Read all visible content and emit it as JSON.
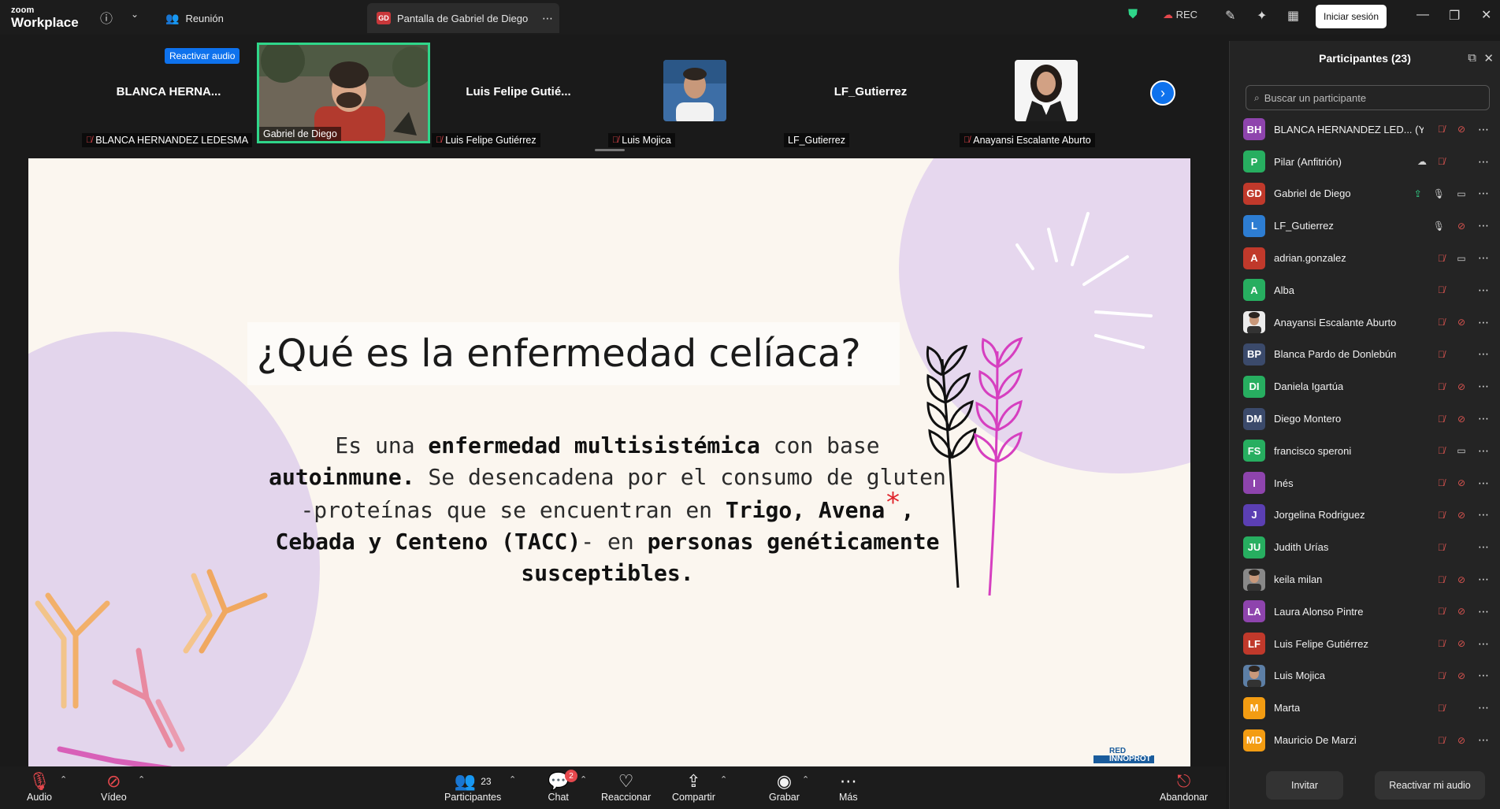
{
  "titlebar": {
    "brand_small": "zoom",
    "brand_large": "Workplace",
    "meeting_tab": "Reunión",
    "share_tab": "Pantalla de Gabriel de Diego",
    "share_badge": "GD",
    "rec_label": "REC",
    "login_button": "Iniciar sesión"
  },
  "gallery": {
    "reactivate_audio": "Reactivar audio",
    "tiles": [
      {
        "big_name": "BLANCA  HERNA...",
        "label": "BLANCA HERNANDEZ LEDESMA"
      },
      {
        "big_name": "",
        "label": "Gabriel de Diego"
      },
      {
        "big_name": "Luis  Felipe  Gutié...",
        "label": "Luis Felipe Gutiérrez"
      },
      {
        "big_name": "",
        "label": "Luis Mojica"
      },
      {
        "big_name": "LF_Gutierrez",
        "label": "LF_Gutierrez"
      },
      {
        "big_name": "",
        "label": "Anayansi Escalante Aburto"
      }
    ]
  },
  "slide": {
    "title": "¿Qué es la enfermedad celíaca?",
    "body": {
      "t1": "Es una ",
      "b1": "enfermedad multisistémica",
      "t2": " con base ",
      "b2": "autoinmune.",
      "t3": " Se desencadena por el consumo de gluten -proteínas que se encuentran en ",
      "b3": "Trigo, Avena",
      "asterisk": "*",
      "b4": ", Cebada y Centeno (TACC)",
      "t4": "- en ",
      "b5": "personas genéticamente susceptibles."
    },
    "logo_line1": "RED",
    "logo_line2": "INNOPROT"
  },
  "panel": {
    "title": "Participantes (23)",
    "search_placeholder": "Buscar un participante",
    "invite": "Invitar",
    "unmute_me": "Reactivar mi audio",
    "participants": [
      {
        "initials": "BH",
        "name": "BLANCA HERNANDEZ LED... (Yo)",
        "color": "#8e44ad",
        "mic": "muted",
        "cam": "off"
      },
      {
        "initials": "P",
        "name": "Pilar (Anfitrión)",
        "color": "#27ae60",
        "mic": "muted",
        "cam": "none",
        "extra": "cloud"
      },
      {
        "initials": "GD",
        "name": "Gabriel de Diego",
        "color": "#c0392b",
        "mic": "on",
        "cam": "on",
        "extra": "share"
      },
      {
        "initials": "L",
        "name": "LF_Gutierrez",
        "color": "#2d7dd2",
        "mic": "on",
        "cam": "off"
      },
      {
        "initials": "A",
        "name": "adrian.gonzalez",
        "color": "#c0392b",
        "mic": "muted",
        "cam": "on"
      },
      {
        "initials": "A",
        "name": "Alba",
        "color": "#27ae60",
        "mic": "muted",
        "cam": "none"
      },
      {
        "initials": "",
        "name": "Anayansi Escalante Aburto",
        "color": "#ececec",
        "mic": "muted",
        "cam": "off",
        "photo": true
      },
      {
        "initials": "BP",
        "name": "Blanca Pardo de Donlebún",
        "color": "#3b4a6b",
        "mic": "muted",
        "cam": "none"
      },
      {
        "initials": "DI",
        "name": "Daniela Igartúa",
        "color": "#27ae60",
        "mic": "muted",
        "cam": "off"
      },
      {
        "initials": "DM",
        "name": "Diego Montero",
        "color": "#3b4a6b",
        "mic": "muted",
        "cam": "off"
      },
      {
        "initials": "FS",
        "name": "francisco speroni",
        "color": "#27ae60",
        "mic": "muted",
        "cam": "on"
      },
      {
        "initials": "I",
        "name": "Inés",
        "color": "#8e44ad",
        "mic": "muted",
        "cam": "off"
      },
      {
        "initials": "J",
        "name": "Jorgelina Rodriguez",
        "color": "#5b3fb3",
        "mic": "muted",
        "cam": "off"
      },
      {
        "initials": "JU",
        "name": "Judith Urías",
        "color": "#27ae60",
        "mic": "muted",
        "cam": "none"
      },
      {
        "initials": "",
        "name": "keila milan",
        "color": "#888888",
        "mic": "muted",
        "cam": "off",
        "photo": true
      },
      {
        "initials": "LA",
        "name": "Laura Alonso Pintre",
        "color": "#8e44ad",
        "mic": "muted",
        "cam": "off"
      },
      {
        "initials": "LF",
        "name": "Luis Felipe Gutiérrez",
        "color": "#c0392b",
        "mic": "muted",
        "cam": "off"
      },
      {
        "initials": "",
        "name": "Luis Mojica",
        "color": "#5d7fa6",
        "mic": "muted",
        "cam": "off",
        "photo": true
      },
      {
        "initials": "M",
        "name": "Marta",
        "color": "#f39c12",
        "mic": "muted",
        "cam": "none"
      },
      {
        "initials": "MD",
        "name": "Mauricio De Marzi",
        "color": "#f39c12",
        "mic": "muted",
        "cam": "off"
      }
    ]
  },
  "toolbar": {
    "audio": "Audio",
    "video": "Vídeo",
    "participants": "Participantes",
    "participants_count": "23",
    "chat": "Chat",
    "chat_badge": "2",
    "react": "Reaccionar",
    "share": "Compartir",
    "record": "Grabar",
    "more": "Más",
    "leave": "Abandonar"
  }
}
